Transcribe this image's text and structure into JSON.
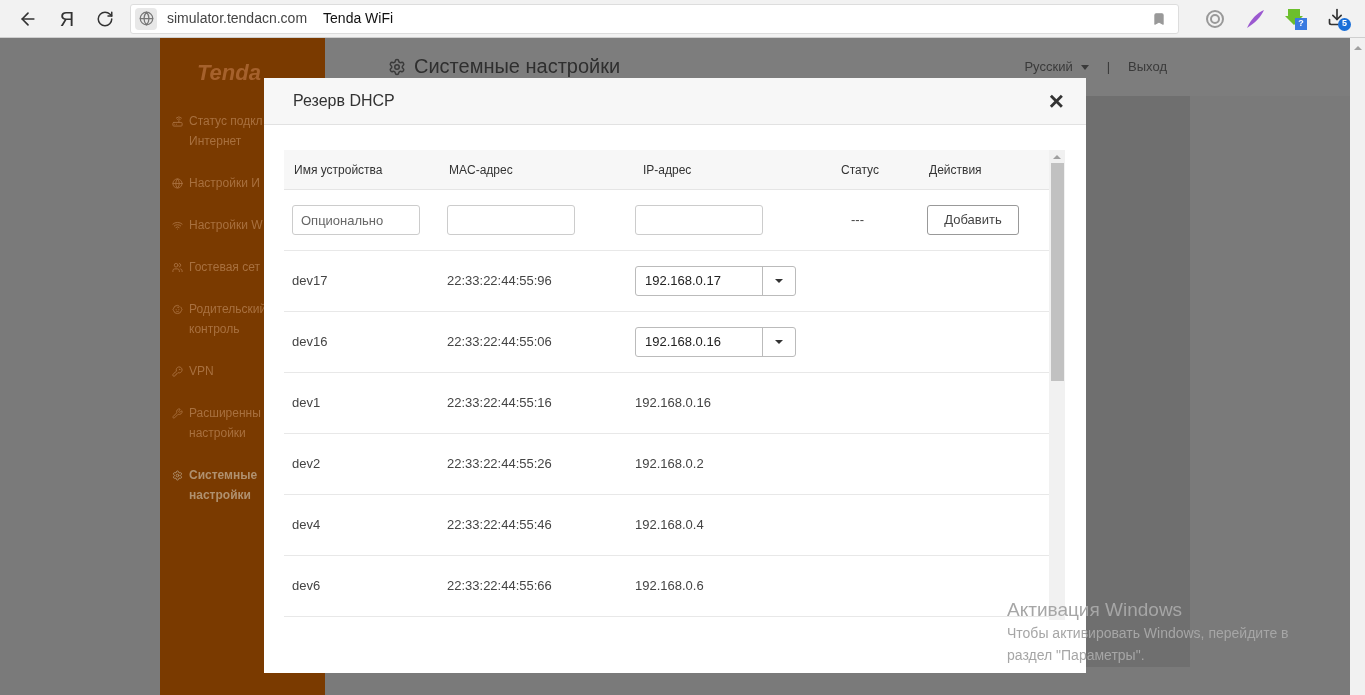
{
  "browser": {
    "logo_letter": "Я",
    "url": "simulator.tendacn.com",
    "page_title": "Tenda WiFi",
    "extension_badge": "?",
    "downloads_badge": "5"
  },
  "sidebar": {
    "logo": "Tenda",
    "items": [
      {
        "label": "Статус подкл",
        "label2": "Интернет",
        "selected": false
      },
      {
        "label": "Настройки И",
        "selected": false
      },
      {
        "label": "Настройки W",
        "selected": false
      },
      {
        "label": "Гостевая сет",
        "selected": false
      },
      {
        "label": "Родительский",
        "label2": "контроль",
        "selected": false
      },
      {
        "label": "VPN",
        "selected": false
      },
      {
        "label": "Расширенны",
        "label2": "настройки",
        "selected": false
      },
      {
        "label": "Системные",
        "label2": "настройки",
        "selected": true
      }
    ]
  },
  "header": {
    "title": "Системные настройки",
    "language": "Русский",
    "separator": "|",
    "logout": "Выход"
  },
  "modal": {
    "title": "Резерв DHCP",
    "close": "×",
    "columns": [
      "Имя устройства",
      "MAC-адрес",
      "IP-адрес",
      "Статус",
      "Действия"
    ],
    "new_row": {
      "name_placeholder": "Опционально",
      "status": "---",
      "add_button": "Добавить"
    },
    "rows": [
      {
        "name": "dev17",
        "mac": "22:33:22:44:55:96",
        "ip": "192.168.0.17",
        "kind": "select"
      },
      {
        "name": "dev16",
        "mac": "22:33:22:44:55:06",
        "ip": "192.168.0.16",
        "kind": "select"
      },
      {
        "name": "dev1",
        "mac": "22:33:22:44:55:16",
        "ip": "192.168.0.16",
        "kind": "text"
      },
      {
        "name": "dev2",
        "mac": "22:33:22:44:55:26",
        "ip": "192.168.0.2",
        "kind": "text"
      },
      {
        "name": "dev4",
        "mac": "22:33:22:44:55:46",
        "ip": "192.168.0.4",
        "kind": "text"
      },
      {
        "name": "dev6",
        "mac": "22:33:22:44:55:66",
        "ip": "192.168.0.6",
        "kind": "text"
      }
    ]
  },
  "watermark": {
    "title": "Активация Windows",
    "line1": "Чтобы активировать Windows, перейдите в",
    "line2": "раздел \"Параметры\"."
  }
}
